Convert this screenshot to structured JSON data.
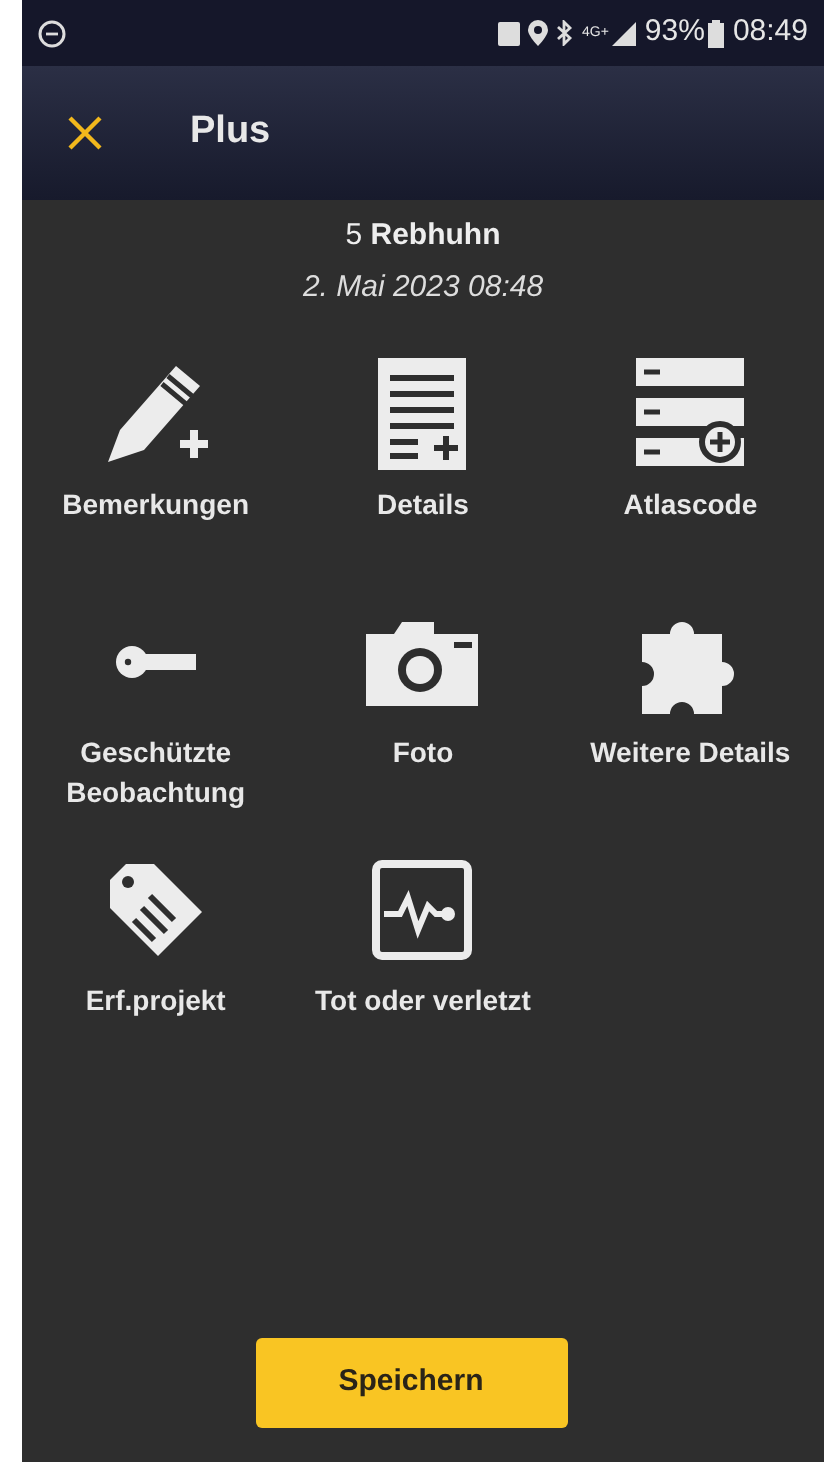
{
  "status_bar": {
    "network": "4G+",
    "battery": "93%",
    "time": "08:49"
  },
  "header": {
    "title": "Plus"
  },
  "observation": {
    "count": "5",
    "species": "Rebhuhn",
    "datetime": "2. Mai 2023 08:48"
  },
  "actions": [
    {
      "kind": "notes",
      "label": "Bemerkungen"
    },
    {
      "kind": "details",
      "label": "Details"
    },
    {
      "kind": "atlas",
      "label": "Atlascode"
    },
    {
      "kind": "protected",
      "label": "Geschützte Beobachtung"
    },
    {
      "kind": "photo",
      "label": "Foto"
    },
    {
      "kind": "more",
      "label": "Weitere Details"
    },
    {
      "kind": "project",
      "label": "Erf.projekt"
    },
    {
      "kind": "injured",
      "label": "Tot oder verletzt"
    }
  ],
  "save_button": "Speichern"
}
